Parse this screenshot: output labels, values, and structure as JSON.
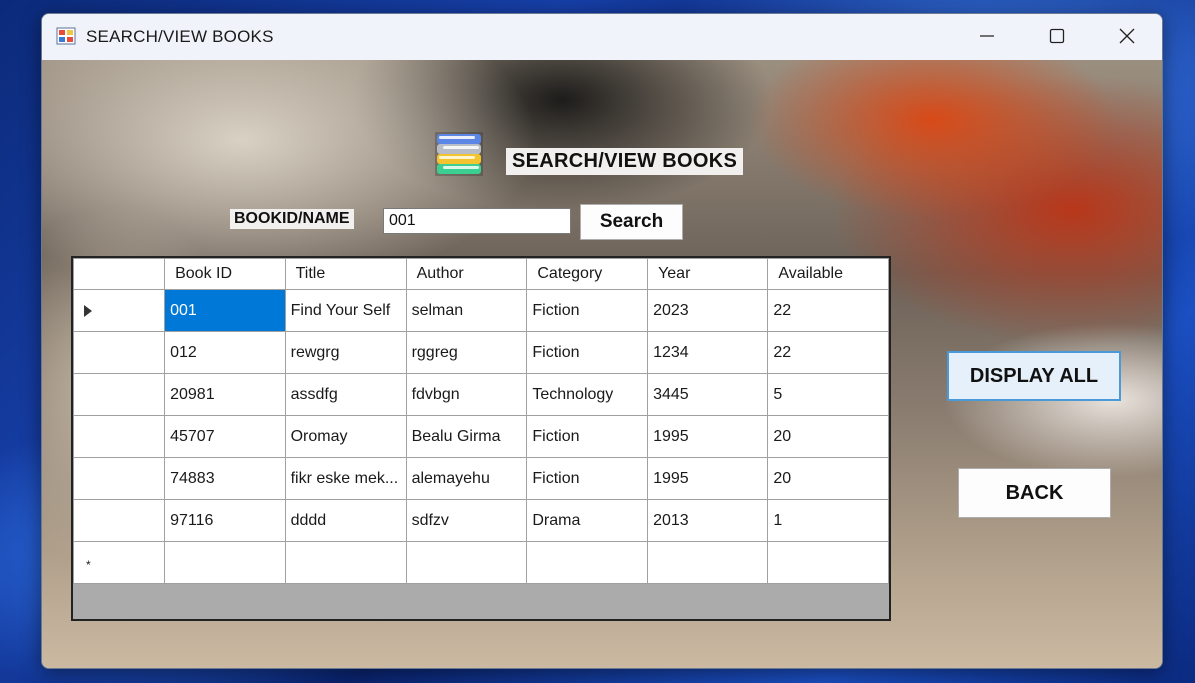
{
  "window": {
    "title": "SEARCH/VIEW BOOKS"
  },
  "form": {
    "heading": "SEARCH/VIEW BOOKS",
    "search_label": "BOOKID/NAME",
    "search_value": "001",
    "search_button": "Search",
    "display_all_button": "DISPLAY ALL",
    "back_button": "BACK"
  },
  "grid": {
    "columns": [
      "Book ID",
      "Title",
      "Author",
      "Category",
      "Year",
      "Available"
    ],
    "rows": [
      [
        "001",
        "Find Your Self",
        "selman",
        "Fiction",
        "2023",
        "22"
      ],
      [
        "012",
        "rewgrg",
        "rggreg",
        "Fiction",
        "1234",
        "22"
      ],
      [
        "20981",
        "assdfg",
        "fdvbgn",
        "Technology",
        "3445",
        "5"
      ],
      [
        "45707",
        "Oromay",
        "Bealu Girma",
        "Fiction",
        "1995",
        "20"
      ],
      [
        "74883",
        "fikr eske mek...",
        "alemayehu",
        "Fiction",
        "1995",
        "20"
      ],
      [
        "97116",
        "dddd",
        "sdfzv",
        "Drama",
        "2013",
        "1"
      ]
    ],
    "new_row_marker": "*"
  },
  "colors": {
    "selection": "#0078d7",
    "display_all_border": "#4a9ad8"
  },
  "icons": [
    "app-icon",
    "minimize-icon",
    "maximize-icon",
    "close-icon",
    "books-icon",
    "current-row-arrow-icon"
  ]
}
